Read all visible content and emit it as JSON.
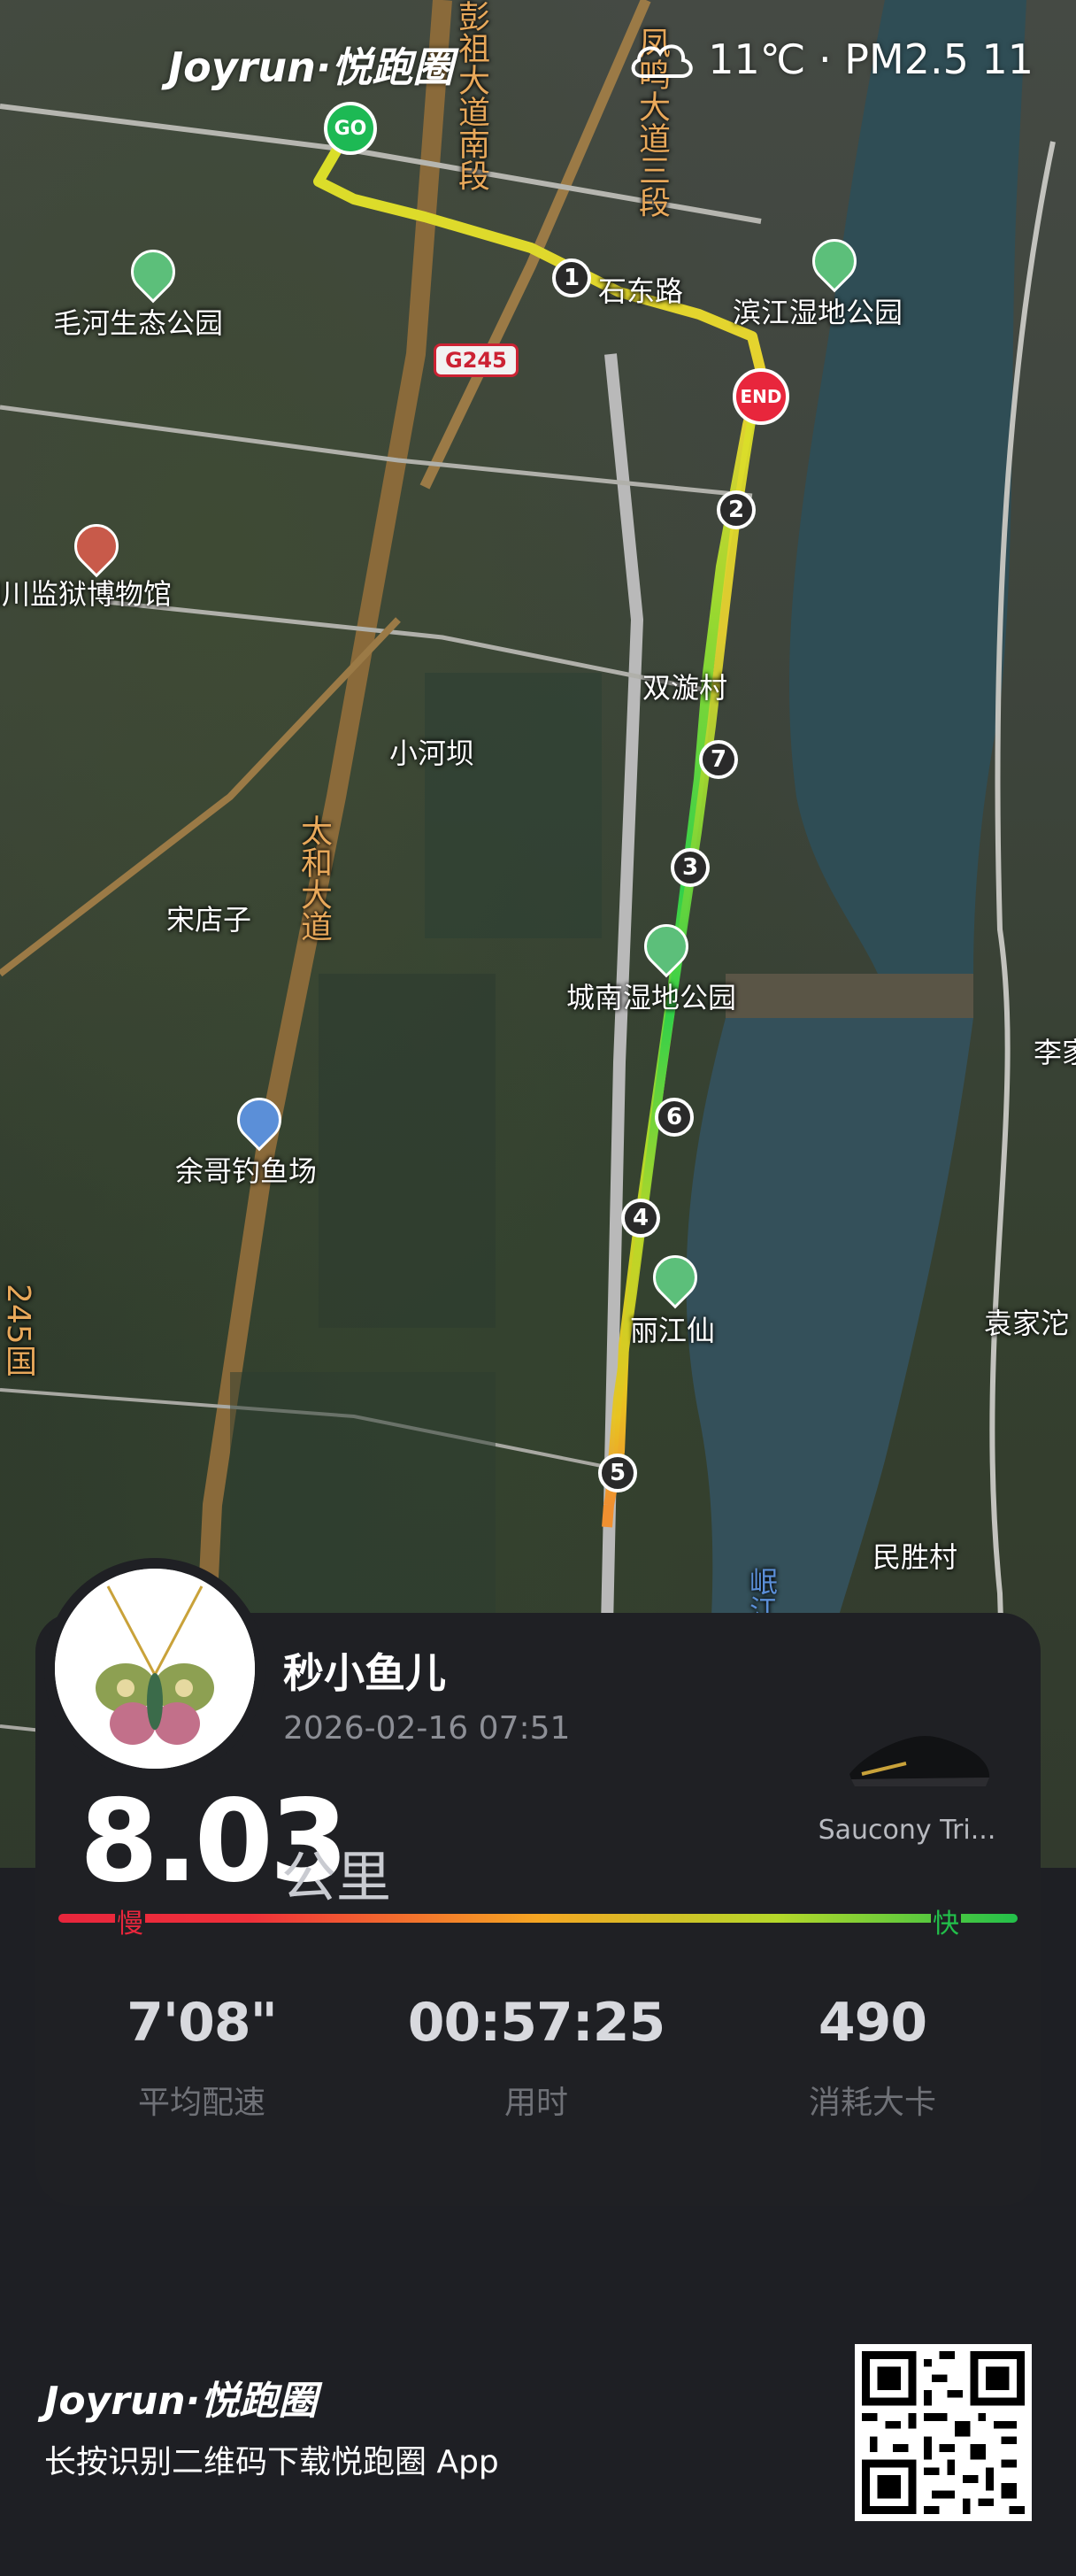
{
  "header": {
    "brand": "Joyrun·悦跑圈",
    "weather_icon": "cloud-icon",
    "weather_text": "11℃ · PM2.5 11"
  },
  "map": {
    "labels": {
      "maohe_park": "毛河生态公园",
      "binjiang_park": "滨江湿地公园",
      "prison_museum": "四川监狱博物馆",
      "shuangxuan": "双漩村",
      "xiaoheba": "小河坝",
      "taihe_avenue": "太和大道",
      "songdianzi": "宋店子",
      "chengnan_park": "城南湿地公园",
      "yuge_fishpond": "余哥钓鱼场",
      "lijiang": "丽江仙",
      "yuanjia": "袁家沱",
      "minsheng": "民胜村",
      "li": "李家",
      "pengzu_road": "彭祖大道南段",
      "fengming_road": "凤鸣大道三段",
      "shiyan_road": "石东路",
      "road_245": "245国",
      "min_river": "岷江"
    },
    "highway_shield": "G245",
    "start_label": "GO",
    "end_label": "END",
    "km_markers": [
      "1",
      "2",
      "3",
      "4",
      "5",
      "6",
      "7"
    ]
  },
  "card": {
    "username": "秒小鱼儿",
    "datetime": "2026-02-16 07:51",
    "shoe": "Saucony Tri...",
    "distance": "8.03",
    "distance_unit": "公里",
    "slow_label": "慢",
    "fast_label": "快",
    "stats": [
      {
        "value": "7'08\"",
        "label": "平均配速"
      },
      {
        "value": "00:57:25",
        "label": "用时"
      },
      {
        "value": "490",
        "label": "消耗大卡"
      }
    ]
  },
  "footer": {
    "brand": "Joyrun·悦跑圈",
    "tagline": "长按识别二维码下载悦跑圈 App"
  },
  "colors": {
    "route_slow": "#e8263c",
    "route_mid": "#f5c518",
    "route_fast": "#22c04a",
    "card_bg": "#1f2024"
  }
}
